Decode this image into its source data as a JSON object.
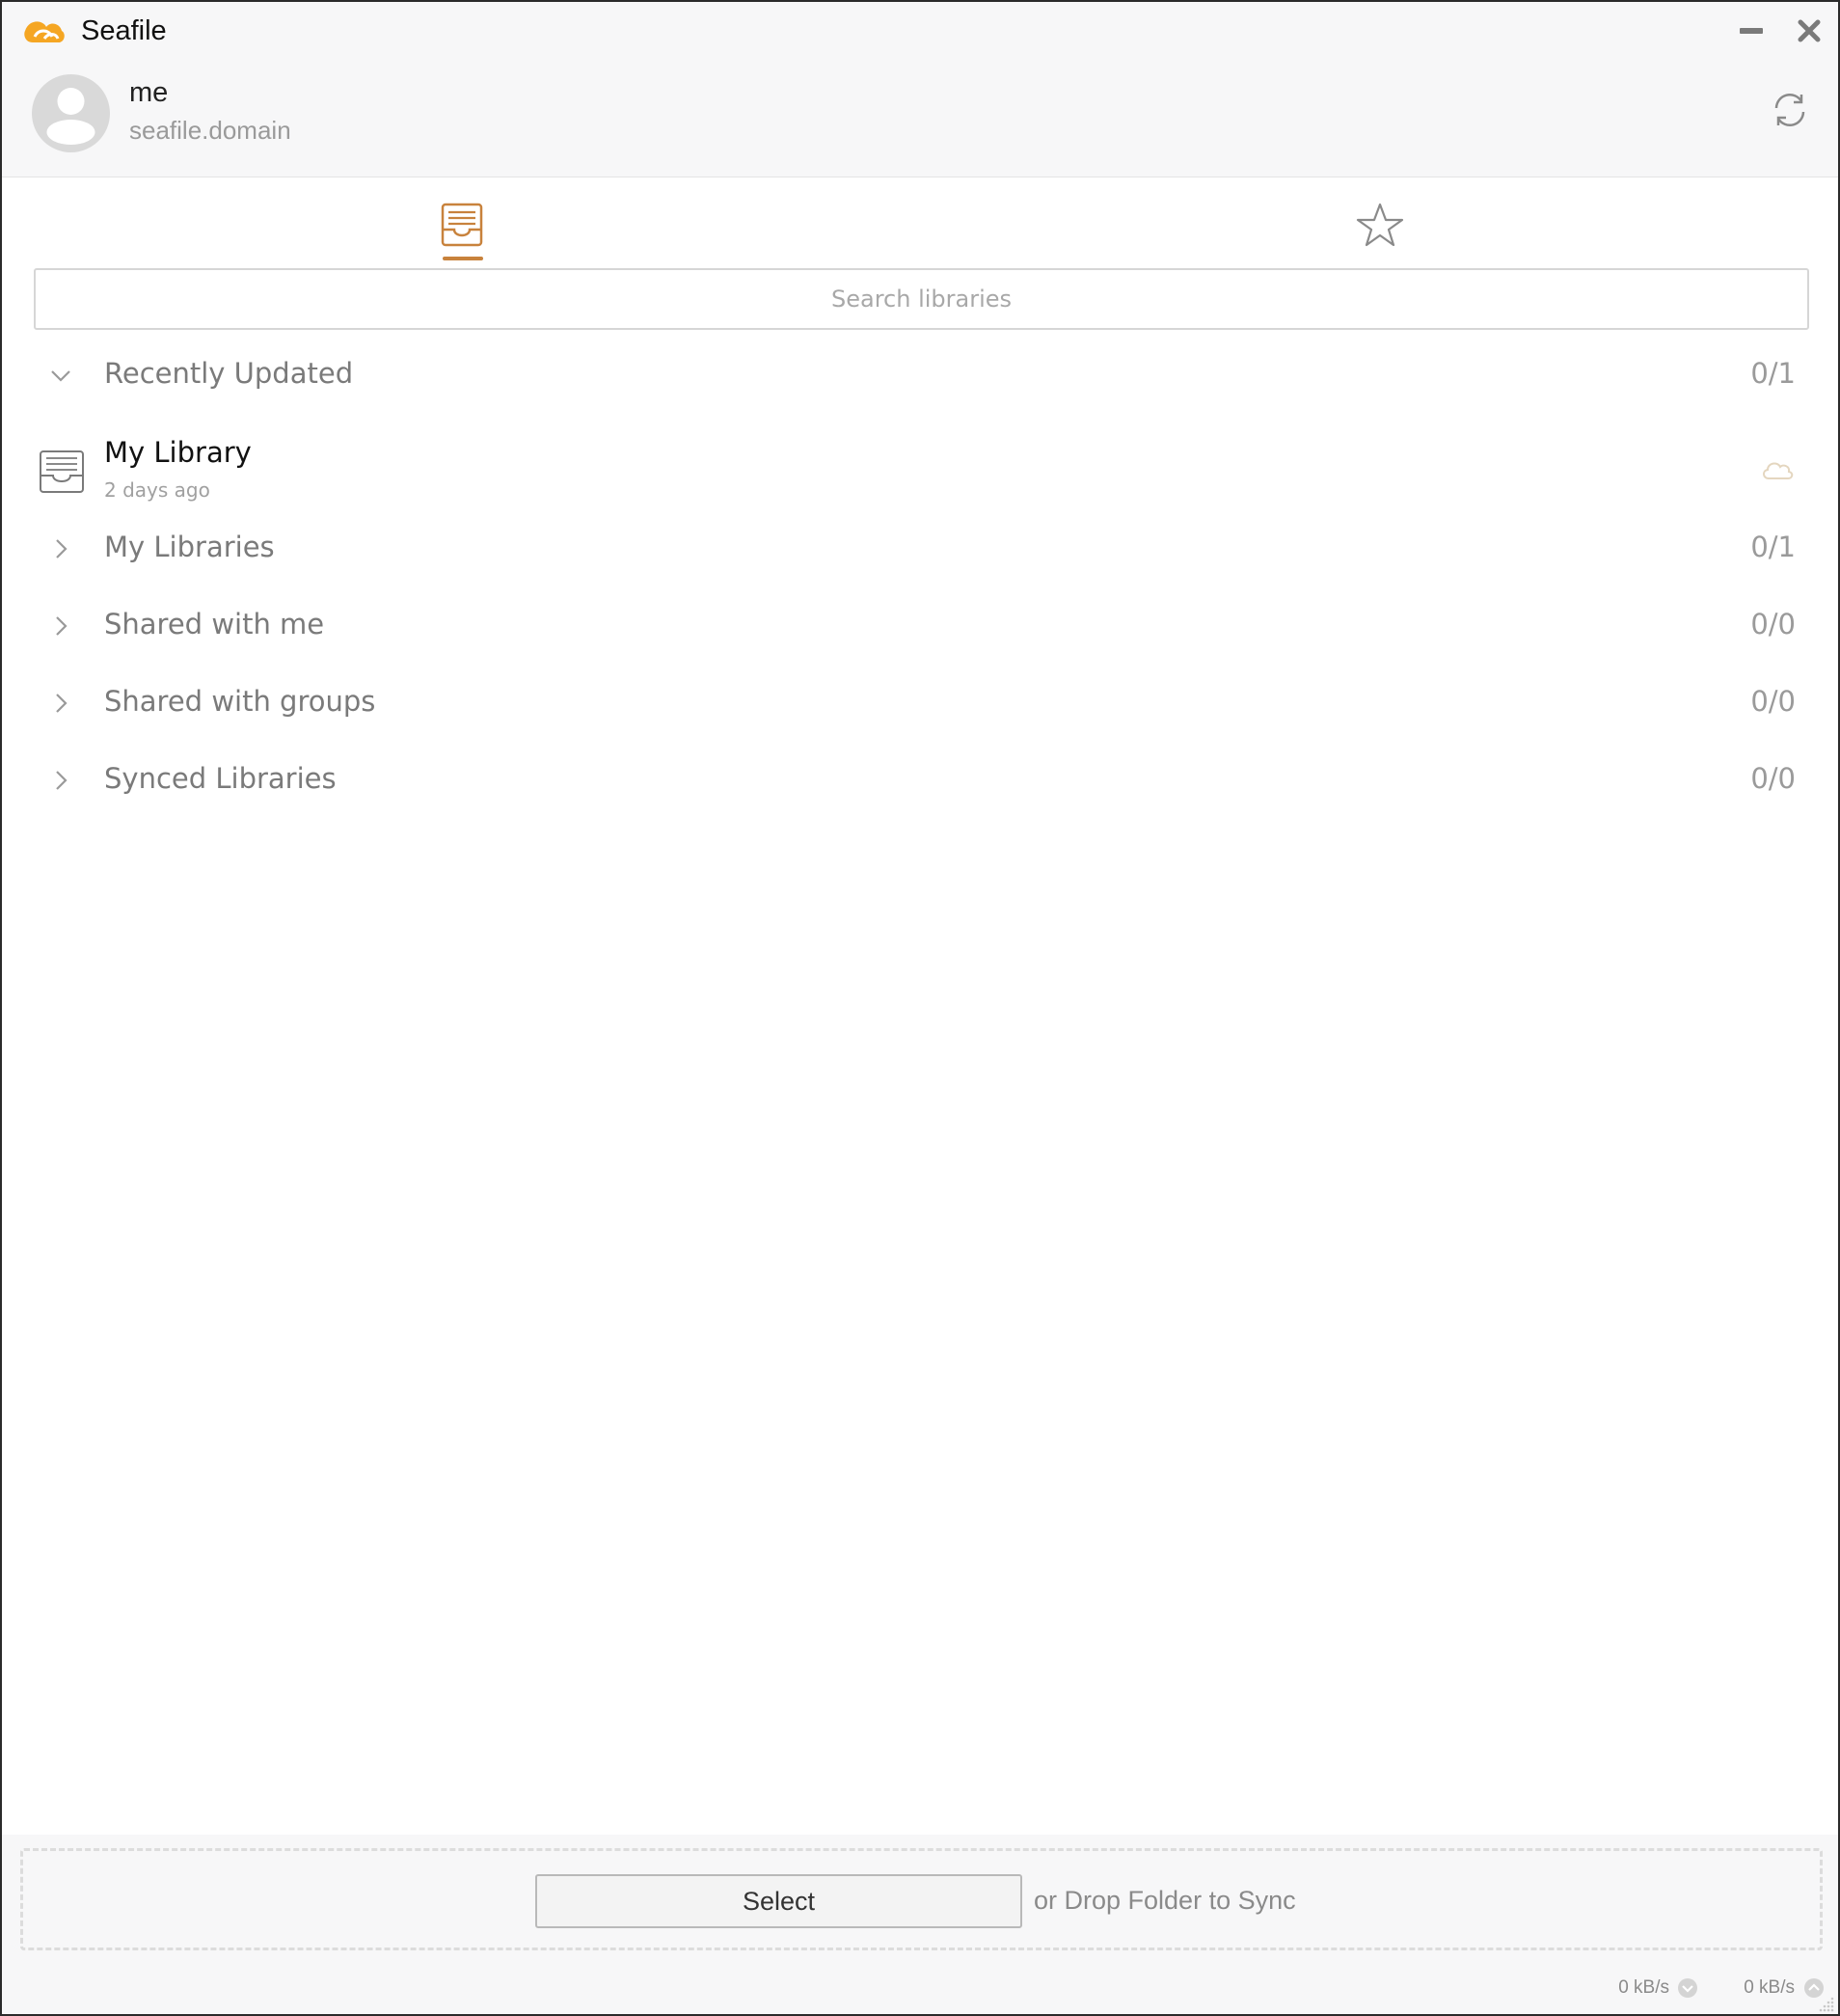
{
  "window": {
    "title": "Seafile"
  },
  "account": {
    "name": "me",
    "server": "seafile.domain"
  },
  "tabs": [
    {
      "name": "libraries",
      "icon": "library-tray-icon",
      "active": true
    },
    {
      "name": "starred",
      "icon": "star-icon",
      "active": false
    }
  ],
  "search": {
    "placeholder": "Search libraries",
    "value": ""
  },
  "groups": [
    {
      "label": "Recently Updated",
      "count": "0/1",
      "expanded": true,
      "repos": [
        {
          "name": "My Library",
          "time": "2 days ago",
          "status_icon": "cloud-icon"
        }
      ]
    },
    {
      "label": "My Libraries",
      "count": "0/1",
      "expanded": false
    },
    {
      "label": "Shared with me",
      "count": "0/0",
      "expanded": false
    },
    {
      "label": "Shared with groups",
      "count": "0/0",
      "expanded": false
    },
    {
      "label": "Synced Libraries",
      "count": "0/0",
      "expanded": false
    }
  ],
  "dropzone": {
    "button_label": "Select",
    "hint": "or Drop Folder to Sync"
  },
  "status": {
    "download_rate": "0 kB/s",
    "upload_rate": "0 kB/s"
  },
  "colors": {
    "accent": "#c8823c",
    "logo": "#f5a623",
    "muted_text": "#7a7a7a",
    "header_bg": "#f7f7f8"
  }
}
